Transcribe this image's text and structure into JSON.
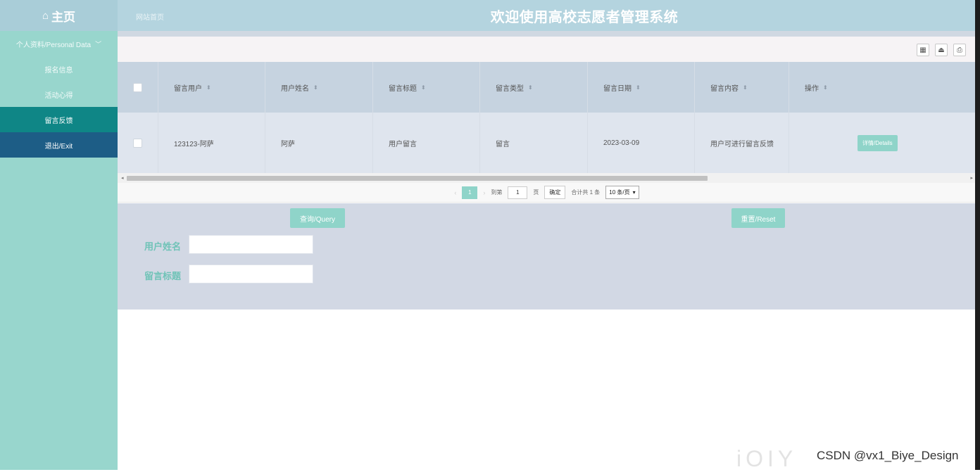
{
  "header": {
    "home_label": "主页",
    "site_link": "网站首页",
    "title": "欢迎使用高校志愿者管理系统"
  },
  "sidebar": {
    "group_label": "个人资料/Personal Data",
    "items": [
      {
        "label": "报名信息"
      },
      {
        "label": "活动心得"
      },
      {
        "label": "留言反馈"
      },
      {
        "label": "退出/Exit"
      }
    ]
  },
  "table": {
    "headers": [
      "留言用户",
      "用户姓名",
      "留言标题",
      "留言类型",
      "留言日期",
      "留言内容",
      "操作"
    ],
    "rows": [
      {
        "user": "123123-阿萨",
        "name": "阿萨",
        "title": "用户留言",
        "type": "留言",
        "date": "2023-03-09",
        "content": "用户可进行留言反馈",
        "action": "详情/Details"
      }
    ]
  },
  "pager": {
    "prev": "‹",
    "current": "1",
    "next": "›",
    "goto_label": "到第",
    "page_input": "1",
    "page_unit": "页",
    "confirm": "确定",
    "total": "合计共 1 条",
    "page_size": "10 条/页"
  },
  "search": {
    "query_button": "查询/Query",
    "reset_button": "重置/Reset",
    "fields": [
      {
        "label": "用户姓名",
        "value": ""
      },
      {
        "label": "留言标题",
        "value": ""
      }
    ]
  },
  "watermark": {
    "text": "CSDN @vx1_Biye_Design",
    "logo": "iOIY"
  }
}
